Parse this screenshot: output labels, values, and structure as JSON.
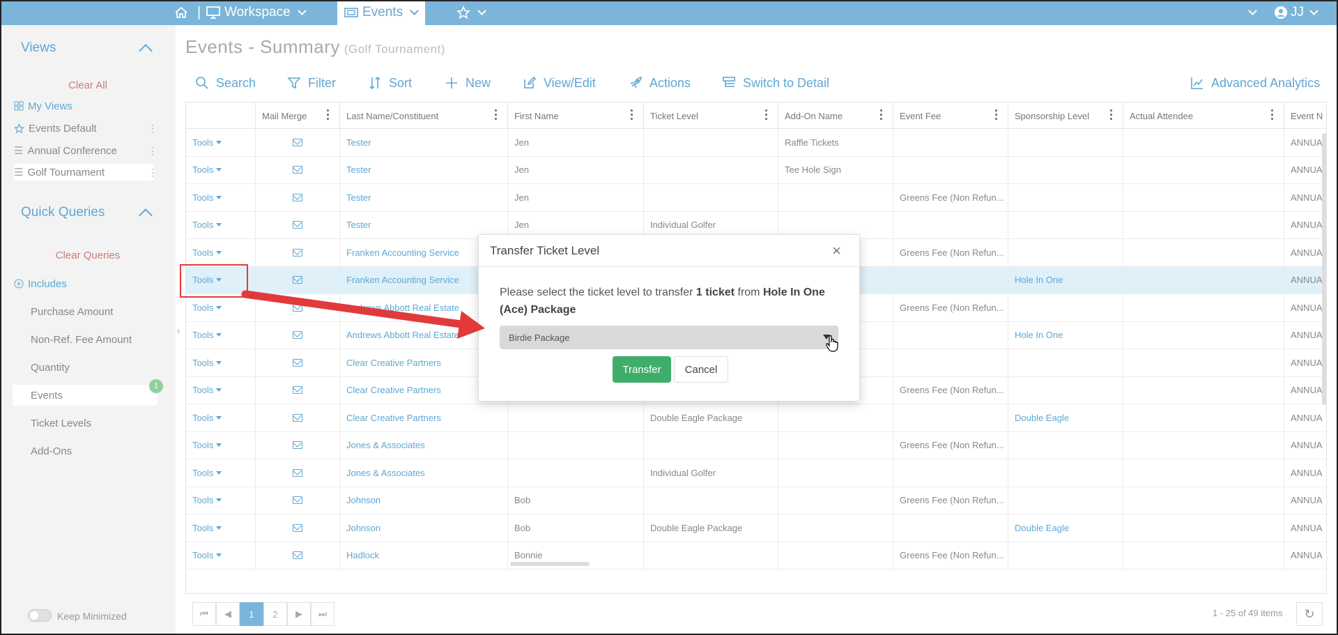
{
  "topbar": {
    "workspace_label": "Workspace",
    "events_label": "Events",
    "user_initials": "JJ"
  },
  "sidebar": {
    "views_title": "Views",
    "clear_all": "Clear All",
    "view_items": [
      {
        "label": "My Views",
        "icon": "grid-icon"
      },
      {
        "label": "Events Default",
        "icon": "star-icon"
      },
      {
        "label": "Annual Conference",
        "icon": "list-icon"
      },
      {
        "label": "Golf Tournament",
        "icon": "list-icon"
      }
    ],
    "quick_title": "Quick Queries",
    "clear_queries": "Clear Queries",
    "includes_label": "Includes",
    "query_items": [
      "Purchase Amount",
      "Non-Ref. Fee Amount",
      "Quantity",
      "Events",
      "Ticket Levels",
      "Add-Ons"
    ],
    "events_badge": "1",
    "keep_minimized": "Keep Minimized"
  },
  "page": {
    "title": "Events - Summary",
    "subtitle": "(Golf Tournament)"
  },
  "toolbar": {
    "search": "Search",
    "filter": "Filter",
    "sort": "Sort",
    "new": "New",
    "view_edit": "View/Edit",
    "actions": "Actions",
    "switch": "Switch to Detail",
    "analytics": "Advanced Analytics"
  },
  "grid": {
    "headers": [
      "",
      "Mail Merge",
      "Last Name/Constituent",
      "First Name",
      "Ticket Level",
      "Add-On Name",
      "Event Fee",
      "Sponsorship Level",
      "Actual Attendee",
      "Event N"
    ],
    "tools_label": "Tools",
    "rows": [
      {
        "last": "Tester",
        "first": "Jen",
        "ticket": "",
        "addon": "Raffle Tickets",
        "fee": "",
        "sponsor": "",
        "event": "ANNUA"
      },
      {
        "last": "Tester",
        "first": "Jen",
        "ticket": "",
        "addon": "Tee Hole Sign",
        "fee": "",
        "sponsor": "",
        "event": "ANNUA"
      },
      {
        "last": "Tester",
        "first": "Jen",
        "ticket": "",
        "addon": "",
        "fee": "Greens Fee (Non Refun...",
        "sponsor": "",
        "event": "ANNUA"
      },
      {
        "last": "Tester",
        "first": "Jen",
        "ticket": "Individual Golfer",
        "addon": "",
        "fee": "",
        "sponsor": "",
        "event": "ANNUA"
      },
      {
        "last": "Franken Accounting Service",
        "first": "",
        "ticket": "",
        "addon": "",
        "fee": "Greens Fee (Non Refun...",
        "sponsor": "",
        "event": "ANNUA"
      },
      {
        "last": "Franken Accounting Service",
        "first": "",
        "ticket": "",
        "addon": "",
        "fee": "",
        "sponsor": "Hole In One",
        "event": "ANNUA"
      },
      {
        "last": "Andrews Abbott Real Estate",
        "first": "",
        "ticket": "",
        "addon": "",
        "fee": "Greens Fee (Non Refun...",
        "sponsor": "",
        "event": "ANNUA"
      },
      {
        "last": "Andrews Abbott Real Estate",
        "first": "",
        "ticket": "",
        "addon": "",
        "fee": "",
        "sponsor": "Hole In One",
        "event": "ANNUA"
      },
      {
        "last": "Clear Creative Partners",
        "first": "",
        "ticket": "",
        "addon": "",
        "fee": "",
        "sponsor": "",
        "event": "ANNUA"
      },
      {
        "last": "Clear Creative Partners",
        "first": "",
        "ticket": "",
        "addon": "",
        "fee": "Greens Fee (Non Refun...",
        "sponsor": "",
        "event": "ANNUA"
      },
      {
        "last": "Clear Creative Partners",
        "first": "",
        "ticket": "Double Eagle Package",
        "addon": "",
        "fee": "",
        "sponsor": "Double Eagle",
        "event": "ANNUA"
      },
      {
        "last": "Jones & Associates",
        "first": "",
        "ticket": "",
        "addon": "",
        "fee": "Greens Fee (Non Refun...",
        "sponsor": "",
        "event": "ANNUA"
      },
      {
        "last": "Jones & Associates",
        "first": "",
        "ticket": "Individual Golfer",
        "addon": "",
        "fee": "",
        "sponsor": "",
        "event": "ANNUA"
      },
      {
        "last": "Johnson",
        "first": "Bob",
        "ticket": "",
        "addon": "",
        "fee": "Greens Fee (Non Refun...",
        "sponsor": "",
        "event": "ANNUA"
      },
      {
        "last": "Johnson",
        "first": "Bob",
        "ticket": "Double Eagle Package",
        "addon": "",
        "fee": "",
        "sponsor": "Double Eagle",
        "event": "ANNUA"
      },
      {
        "last": "Hadlock",
        "first": "Bonnie",
        "ticket": "",
        "addon": "",
        "fee": "Greens Fee (Non Refun...",
        "sponsor": "",
        "event": "ANNUA"
      }
    ]
  },
  "pager": {
    "pages": [
      "1",
      "2"
    ],
    "info": "1 - 25 of 49 items"
  },
  "modal": {
    "title": "Transfer Ticket Level",
    "msg_pre": "Please select the ticket level to transfer ",
    "msg_count": "1 ticket",
    "msg_mid": " from ",
    "msg_level": "Hole In One (Ace) Package",
    "selected": "Birdie Package",
    "transfer": "Transfer",
    "cancel": "Cancel"
  },
  "colors": {
    "accent": "#7bb5d9",
    "link": "#5fa7d3",
    "success": "#3fae6a",
    "annotation": "#e23a3a"
  }
}
